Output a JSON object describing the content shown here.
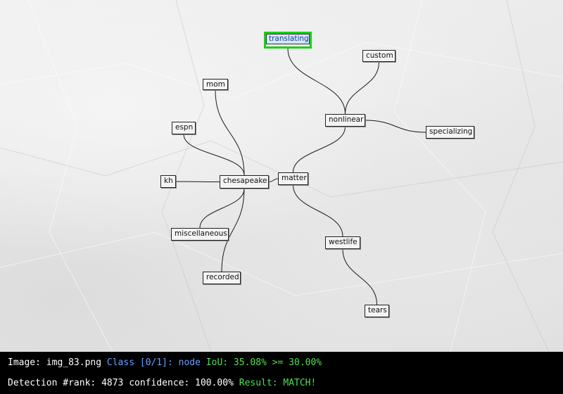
{
  "diagram": {
    "nodes": [
      {
        "id": "translating",
        "label": "translating",
        "selected": true
      },
      {
        "id": "custom",
        "label": "custom"
      },
      {
        "id": "mom",
        "label": "mom"
      },
      {
        "id": "nonlinear",
        "label": "nonlinear"
      },
      {
        "id": "espn",
        "label": "espn"
      },
      {
        "id": "specializing",
        "label": "specializing"
      },
      {
        "id": "kh",
        "label": "kh"
      },
      {
        "id": "chesapeake",
        "label": "chesapeake"
      },
      {
        "id": "matter",
        "label": "matter"
      },
      {
        "id": "miscellaneous",
        "label": "miscellaneous"
      },
      {
        "id": "westlife",
        "label": "westlife"
      },
      {
        "id": "recorded",
        "label": "recorded"
      },
      {
        "id": "tears",
        "label": "tears"
      }
    ],
    "edges": [
      [
        "chesapeake",
        "mom"
      ],
      [
        "chesapeake",
        "espn"
      ],
      [
        "chesapeake",
        "kh"
      ],
      [
        "chesapeake",
        "miscellaneous"
      ],
      [
        "chesapeake",
        "recorded"
      ],
      [
        "chesapeake",
        "matter"
      ],
      [
        "matter",
        "nonlinear"
      ],
      [
        "matter",
        "westlife"
      ],
      [
        "nonlinear",
        "translating"
      ],
      [
        "nonlinear",
        "custom"
      ],
      [
        "nonlinear",
        "specializing"
      ],
      [
        "westlife",
        "tears"
      ]
    ]
  },
  "status": {
    "image_label": "Image: ",
    "image_name": "img_83.png",
    "class_text": " Class [0/1]: node ",
    "iou_text": "IoU: 35.08% >= 30.00%",
    "rank_label": "Detection #rank: ",
    "rank_value": "4873",
    "confidence_text": " confidence: 100.00% ",
    "result_text": "Result: MATCH!"
  },
  "colors": {
    "highlight": "#19d119",
    "class_text": "#6aa0ff",
    "ok_text": "#4fe04f"
  }
}
